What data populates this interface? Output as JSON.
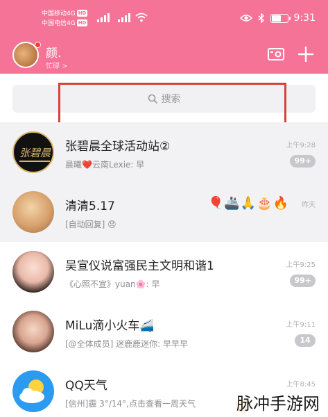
{
  "status_bar": {
    "carrier1": "中国移动4G",
    "carrier2": "中国电信4G",
    "hd": "HD",
    "time": "9:31"
  },
  "header": {
    "user_name": "颜.",
    "user_status": "忙碌 >"
  },
  "search": {
    "placeholder": "搜索"
  },
  "chats": [
    {
      "name": "张碧晨全球活动站②",
      "message": "晨曦❤️云南Lexie: 早",
      "time": "上午9:28",
      "badge": "99+"
    },
    {
      "name": "清清5.17",
      "message": "[自动回复] 😞",
      "time": "昨天",
      "badge": ""
    },
    {
      "name": "吴宣仪说富强民主文明和谐1",
      "message": "《心照不宣》yuan🌸: 早",
      "time": "上午9:25",
      "badge": "99+"
    },
    {
      "name": "MiLu滴小火车🚄",
      "message": "[@全体成员] 迷鹿鹿迷你: 早早早",
      "time": "上午9:11",
      "badge": "14"
    },
    {
      "name": "QQ天气",
      "message": "[信州]霾 3°/14°,点击查看一周天气",
      "time": "上午8:45",
      "badge": ""
    }
  ],
  "watermark": "脉冲手游网",
  "colors": {
    "brand": "#f67398",
    "highlight_box": "#d8403a",
    "badge": "#c7c7cc"
  }
}
